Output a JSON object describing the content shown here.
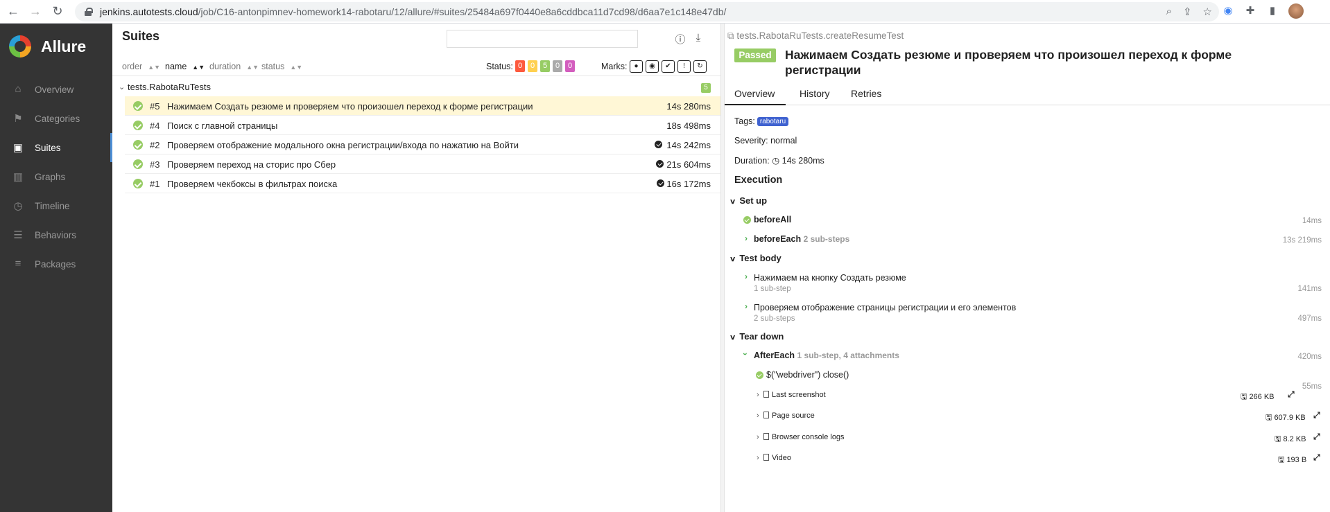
{
  "browser": {
    "url_host": "jenkins.autotests.cloud",
    "url_path": "/job/C16-antonpimnev-homework14-rabotaru/12/allure/#suites/25484a697f0440e8a6cddbca11d7cd98/d6aa7e1c148e47db/"
  },
  "sidebar": {
    "brand": "Allure",
    "items": [
      {
        "label": "Overview",
        "icon": "home-icon"
      },
      {
        "label": "Categories",
        "icon": "flag-icon"
      },
      {
        "label": "Suites",
        "icon": "briefcase-icon"
      },
      {
        "label": "Graphs",
        "icon": "bar-chart-icon"
      },
      {
        "label": "Timeline",
        "icon": "clock-icon"
      },
      {
        "label": "Behaviors",
        "icon": "list-icon"
      },
      {
        "label": "Packages",
        "icon": "align-left-icon"
      }
    ]
  },
  "suites": {
    "title": "Suites",
    "search_value": "",
    "sort": {
      "order": "order",
      "name": "name",
      "duration": "duration",
      "status": "status"
    },
    "status_label": "Status:",
    "status_counts": [
      {
        "value": "0",
        "color": "#fd5a3e"
      },
      {
        "value": "0",
        "color": "#ffd050"
      },
      {
        "value": "5",
        "color": "#97cc64"
      },
      {
        "value": "0",
        "color": "#aaaaaa"
      },
      {
        "value": "0",
        "color": "#d35ebe"
      }
    ],
    "marks_label": "Marks:",
    "group": {
      "name": "tests.RabotaRuTests",
      "count": "5"
    },
    "tests": [
      {
        "num": "#5",
        "name": "Нажимаем Создать резюме и проверяем что произошел переход к форме регистрации",
        "duration": "14s 280ms"
      },
      {
        "num": "#4",
        "name": "Поиск с главной страницы",
        "duration": "18s 498ms"
      },
      {
        "num": "#2",
        "name": "Проверяем отображение модального окна регистрации/входа по нажатию на Войти",
        "duration": "14s 242ms"
      },
      {
        "num": "#3",
        "name": "Проверяем переход на сторис про Сбер",
        "duration": "21s 604ms"
      },
      {
        "num": "#1",
        "name": "Проверяем чекбоксы в фильтрах поиска",
        "duration": "16s 172ms"
      }
    ]
  },
  "detail": {
    "path": "tests.RabotaRuTests.createResumeTest",
    "status": "Passed",
    "title": "Нажимаем Создать резюме и проверяем что произошел переход к форме регистрации",
    "tabs": [
      "Overview",
      "History",
      "Retries"
    ],
    "tags_label": "Tags:",
    "tag": "rabotaru",
    "severity": "Severity: normal",
    "duration_label": "Duration:",
    "duration": "14s 280ms",
    "execution": "Execution",
    "setup": {
      "label": "Set up",
      "before_all": {
        "name": "beforeAll",
        "duration": "14ms"
      },
      "before_each": {
        "name": "beforeEach",
        "sub": "2 sub-steps",
        "duration": "13s 219ms"
      }
    },
    "body": {
      "label": "Test body",
      "steps": [
        {
          "name": "Нажимаем на кнопку Создать резюме",
          "sub": "1 sub-step",
          "duration": "141ms"
        },
        {
          "name": "Проверяем отображение страницы регистрации и его элементов",
          "sub": "2 sub-steps",
          "duration": "497ms"
        }
      ]
    },
    "teardown": {
      "label": "Tear down",
      "after_each": {
        "name": "AfterEach",
        "sub": "1 sub-step, 4 attachments",
        "duration": "420ms"
      },
      "close_step": {
        "name": "$(\"webdriver\") close()",
        "duration": "55ms"
      },
      "attachments": [
        {
          "name": "Last screenshot",
          "size": "266 KB"
        },
        {
          "name": "Page source",
          "size": "607.9 KB"
        },
        {
          "name": "Browser console logs",
          "size": "8.2 KB"
        },
        {
          "name": "Video",
          "size": "193 B"
        }
      ]
    }
  }
}
